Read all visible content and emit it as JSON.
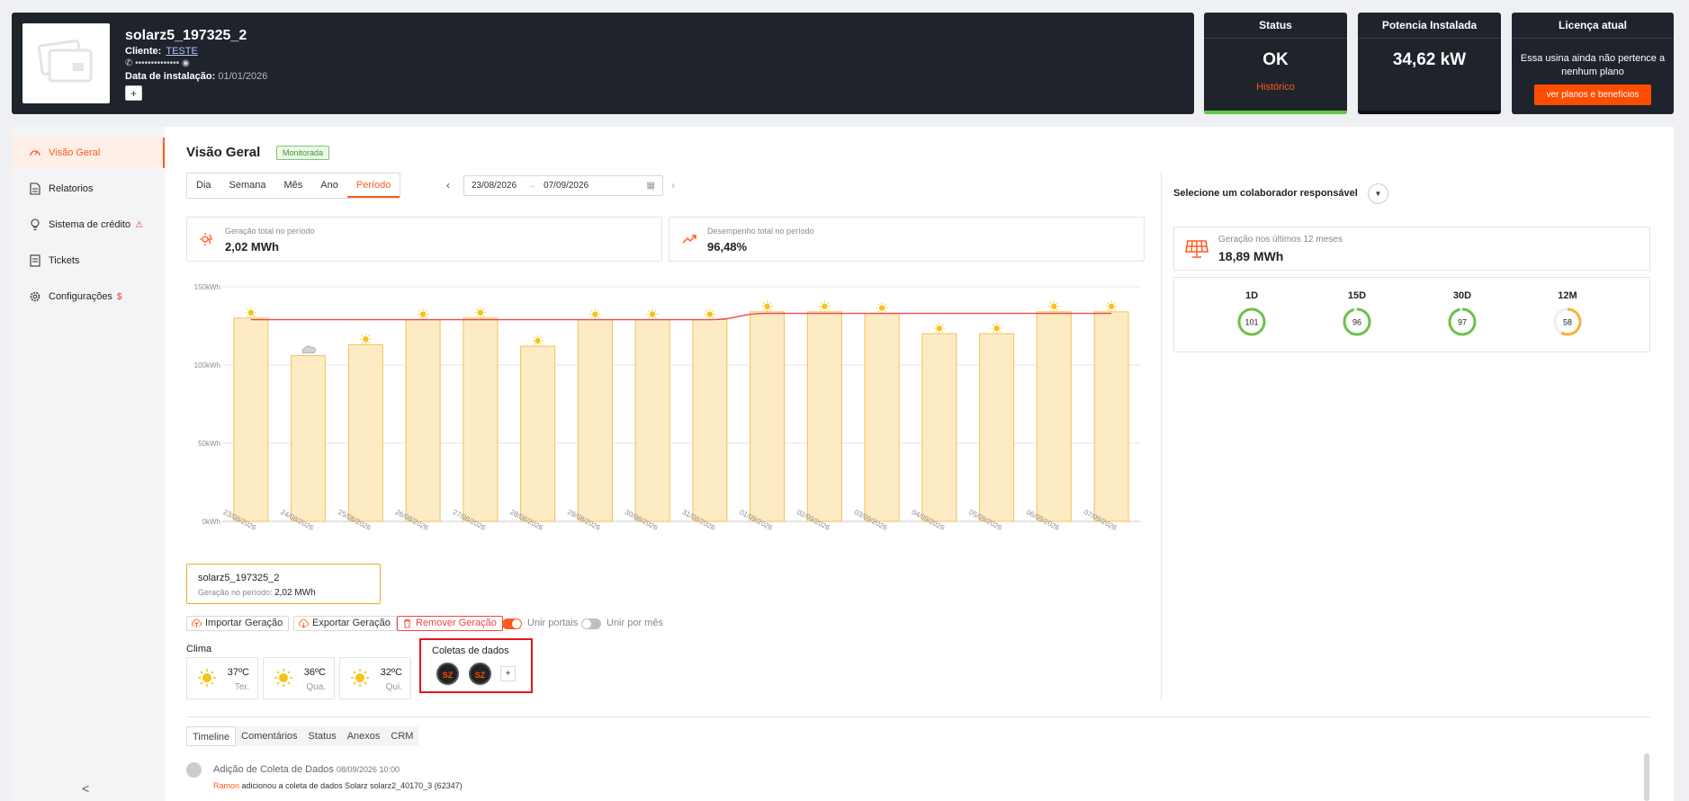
{
  "header": {
    "plant_name": "solarz5_197325_2",
    "client_label": "Cliente:",
    "client_value": "TESTE",
    "phone_masked": "••••••••••••••",
    "install_label": "Data de instalação:",
    "install_value": "01/01/2026",
    "add_label": "+"
  },
  "cards": {
    "status": {
      "title": "Status",
      "value": "OK",
      "link": "Histórico"
    },
    "power": {
      "title": "Potencia Instalada",
      "value": "34,62 kW"
    },
    "license": {
      "title": "Licença atual",
      "text": "Essa usina ainda não pertence a nenhum plano",
      "button": "ver planos e benefícios"
    }
  },
  "sidebar": {
    "items": [
      {
        "label": "Visão Geral",
        "icon": "dashboard-icon",
        "active": true
      },
      {
        "label": "Relatorios",
        "icon": "document-icon"
      },
      {
        "label": "Sistema de crédito",
        "icon": "lightbulb-icon",
        "warn": "⚠"
      },
      {
        "label": "Tickets",
        "icon": "list-icon"
      },
      {
        "label": "Configurações",
        "icon": "gear-icon",
        "warn": "$"
      }
    ],
    "collapse": "<"
  },
  "main": {
    "title": "Visão Geral",
    "badge": "Monitorada",
    "period_tabs": [
      "Dia",
      "Semana",
      "Mês",
      "Ano",
      "Período"
    ],
    "active_tab": "Período",
    "date_start": "23/08/2026",
    "date_end": "07/09/2026",
    "kpi_gen": {
      "label": "Geração total no período",
      "value": "2,02 MWh"
    },
    "kpi_perf": {
      "label": "Desempenho total no período",
      "value": "96,48%"
    },
    "plant_box": {
      "name": "solarz5_197325_2",
      "label": "Geração no período:",
      "value": "2,02 MWh"
    },
    "actions": {
      "import": "Importar Geração",
      "export": "Exportar Geração",
      "remove": "Remover Geração",
      "join_ports": "Unir portais",
      "join_month": "Unir por mês"
    },
    "toggles": {
      "join_ports": true,
      "join_month": false
    },
    "clima": {
      "title": "Clima",
      "days": [
        {
          "temp": "37ºC",
          "day": "Ter."
        },
        {
          "temp": "36ºC",
          "day": "Qua."
        },
        {
          "temp": "32ºC",
          "day": "Qui."
        }
      ]
    },
    "coletas": {
      "title": "Coletas de dados",
      "avatars": [
        "SZ",
        "SZ"
      ],
      "add": "+"
    }
  },
  "right": {
    "collab_title": "Selecione um colaborador responsável",
    "gen12": {
      "label": "Geração nos últimos 12 meses",
      "value": "18,89 MWh"
    },
    "perf": [
      {
        "label": "1D",
        "value": 101,
        "color": "#6cc24a"
      },
      {
        "label": "15D",
        "value": 96,
        "color": "#6cc24a"
      },
      {
        "label": "30D",
        "value": 97,
        "color": "#6cc24a"
      },
      {
        "label": "12M",
        "value": 58,
        "color": "#f5b33a"
      }
    ]
  },
  "bottom": {
    "tabs": [
      "Timeline",
      "Comentários",
      "Status",
      "Anexos",
      "CRM"
    ],
    "active": "Timeline",
    "timeline": {
      "title": "Adição de Coleta de Dados",
      "time": "08/09/2026 10:00",
      "user": "Ramon",
      "text": "adicionou a coleta de dados Solarz solarz2_40170_3 (62347)"
    }
  },
  "chart_data": {
    "type": "bar",
    "categories": [
      "23/08/2026",
      "24/08/2026",
      "25/08/2026",
      "26/08/2026",
      "27/08/2026",
      "28/08/2026",
      "29/08/2026",
      "30/08/2026",
      "31/08/2026",
      "01/09/2026",
      "02/09/2026",
      "03/09/2026",
      "04/09/2026",
      "05/09/2026",
      "06/09/2026",
      "07/09/2026"
    ],
    "series": [
      {
        "type": "bar",
        "values": [
          130,
          106,
          113,
          129,
          130,
          112,
          129,
          129,
          129,
          134,
          134,
          133,
          120,
          120,
          134,
          134
        ],
        "color": "#fdebc4"
      },
      {
        "type": "line",
        "values": [
          129,
          129,
          129,
          129,
          129,
          129,
          129,
          129,
          129,
          133,
          133,
          133,
          133,
          133,
          133,
          133
        ],
        "color": "#e84a4a"
      }
    ],
    "weather": [
      "sun",
      "cloud",
      "sun",
      "sun",
      "sun",
      "sun",
      "sun",
      "sun",
      "sun",
      "sun",
      "sun",
      "sun",
      "sun",
      "sun",
      "sun",
      "sun"
    ],
    "y_ticks": [
      "0kWh",
      "50kWh",
      "100kWh",
      "150kWh"
    ],
    "ylim": [
      0,
      150
    ],
    "grid": true
  }
}
